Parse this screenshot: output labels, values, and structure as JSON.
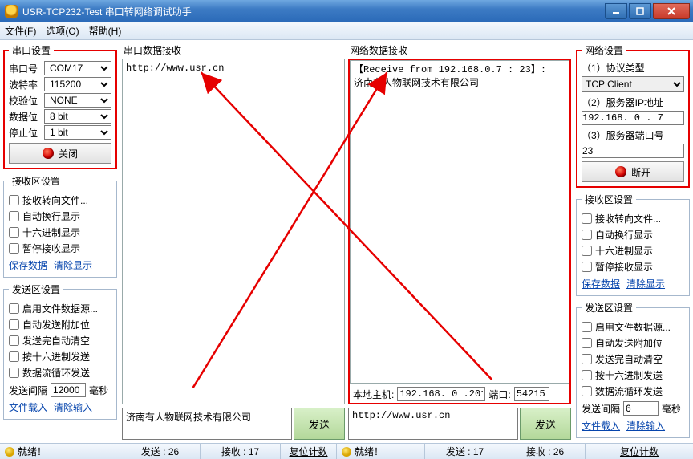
{
  "window": {
    "title": "USR-TCP232-Test 串口转网络调试助手"
  },
  "menus": {
    "file": "文件(F)",
    "options": "选项(O)",
    "help": "帮助(H)"
  },
  "serial": {
    "legend": "串口设置",
    "port_lbl": "串口号",
    "port": "COM17",
    "baud_lbl": "波特率",
    "baud": "115200",
    "parity_lbl": "校验位",
    "parity": "NONE",
    "data_lbl": "数据位",
    "data": "8 bit",
    "stop_lbl": "停止位",
    "stop": "1 bit",
    "close_btn": "关闭"
  },
  "recv_opts_left": {
    "legend": "接收区设置",
    "to_file": "接收转向文件...",
    "auto_wrap": "自动换行显示",
    "hex": "十六进制显示",
    "pause": "暂停接收显示",
    "save": "保存数据",
    "clear": "清除显示"
  },
  "send_opts_left": {
    "legend": "发送区设置",
    "from_file": "启用文件数据源...",
    "auto_append": "自动发送附加位",
    "auto_clear": "发送完自动清空",
    "hex_send": "按十六进制发送",
    "loop": "数据流循环发送",
    "interval_lbl": "发送间隔",
    "interval": "12000",
    "ms": "毫秒",
    "load": "文件载入",
    "clear": "清除输入"
  },
  "serial_recv": {
    "title": "串口数据接收",
    "text": "http://www.usr.cn"
  },
  "net_recv": {
    "title": "网络数据接收",
    "hdr": "【Receive from 192.168.0.7 : 23】:",
    "body": "济南有人物联网技术有限公司"
  },
  "localhost": {
    "lbl": "本地主机:",
    "ip": "192.168. 0 .201",
    "port_lbl": "端口:",
    "port": "54215"
  },
  "serial_send": {
    "text": "济南有人物联网技术有限公司",
    "btn": "发送"
  },
  "net_send": {
    "text": "http://www.usr.cn",
    "btn": "发送"
  },
  "network": {
    "legend": "网络设置",
    "proto_lbl": "（1）协议类型",
    "proto": "TCP Client",
    "ip_lbl": "（2）服务器IP地址",
    "ip": "192.168. 0 . 7",
    "port_lbl": "（3）服务器端口号",
    "port": "23",
    "disconnect_btn": "断开"
  },
  "recv_opts_right": {
    "legend": "接收区设置",
    "to_file": "接收转向文件...",
    "auto_wrap": "自动换行显示",
    "hex": "十六进制显示",
    "pause": "暂停接收显示",
    "save": "保存数据",
    "clear": "清除显示"
  },
  "send_opts_right": {
    "legend": "发送区设置",
    "from_file": "启用文件数据源...",
    "auto_append": "自动发送附加位",
    "auto_clear": "发送完自动清空",
    "hex_send": "按十六进制发送",
    "loop": "数据流循环发送",
    "interval_lbl": "发送间隔",
    "interval": "6",
    "ms": "毫秒",
    "load": "文件载入",
    "clear": "清除输入"
  },
  "status": {
    "ready": "就绪！",
    "s_send": "发送 : 26",
    "s_recv": "接收 : 17",
    "s_reset": "复位计数",
    "n_send": "发送 : 17",
    "n_recv": "接收 : 26",
    "n_reset": "复位计数"
  }
}
